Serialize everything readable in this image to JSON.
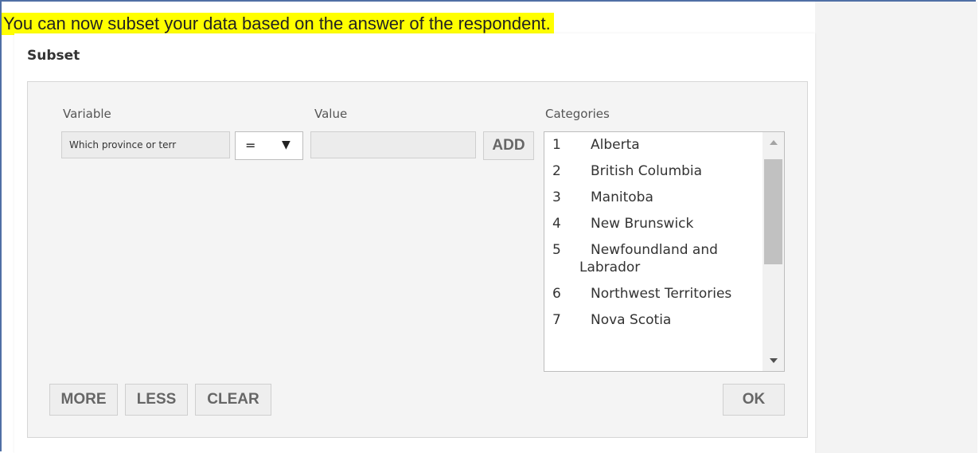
{
  "caption": "You can now subset your data based on the answer of the respondent.",
  "dialog": {
    "title": "Subset",
    "labels": {
      "variable": "Variable",
      "value": "Value",
      "categories": "Categories"
    },
    "variable_value": "Which province or terr",
    "operator": {
      "selected": "=",
      "arrow": "▼"
    },
    "value_field": "",
    "buttons": {
      "add": "ADD",
      "more": "MORE",
      "less": "LESS",
      "clear": "CLEAR",
      "ok": "OK"
    },
    "categories": [
      {
        "num": "1",
        "label": "Alberta"
      },
      {
        "num": "2",
        "label": "British Columbia"
      },
      {
        "num": "3",
        "label": "Manitoba"
      },
      {
        "num": "4",
        "label": "New Brunswick"
      },
      {
        "num": "5",
        "label": "Newfoundland and Labrador"
      },
      {
        "num": "6",
        "label": "Northwest Territories"
      },
      {
        "num": "7",
        "label": "Nova Scotia"
      }
    ]
  },
  "colors": {
    "highlight": "#ffff00",
    "frame_border": "#4f6fa5"
  }
}
